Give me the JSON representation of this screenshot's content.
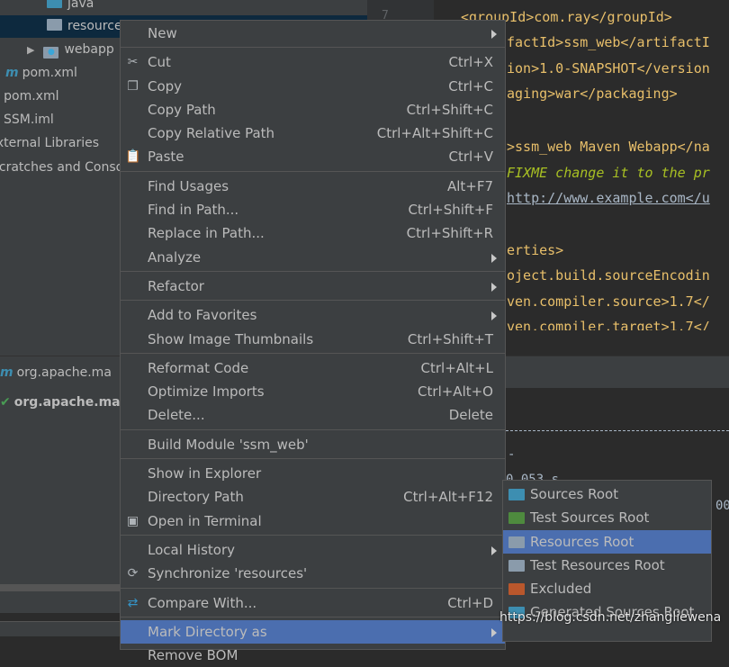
{
  "project_tree": {
    "items": [
      {
        "label": "java",
        "icon": "folder-icon"
      },
      {
        "label": "resources",
        "icon": "folder-icon",
        "selected": true
      },
      {
        "label": "webapp",
        "icon": "web-folder-icon"
      },
      {
        "label": "pom.xml",
        "icon": "maven-icon"
      },
      {
        "label": "pom.xml",
        "icon": "maven-icon"
      },
      {
        "label": "SSM.iml",
        "icon": "iml-icon"
      },
      {
        "label": "External Libraries"
      },
      {
        "label": "Scratches and Consoles"
      }
    ]
  },
  "gutter": {
    "line_number": "7"
  },
  "editor": {
    "lines": [
      "<groupId>com.ray</groupId>",
      "factId>ssm_web</artifactI",
      "ion>1.0-SNAPSHOT</version",
      "aging>war</packaging>",
      ">ssm_web Maven Webapp</na",
      "FIXME change it to the pr",
      "http://www.example.com</u",
      "erties>",
      "oject.build.sourceEncodin",
      "ven.compiler.source>1.7</",
      "ven.compiler.target>1.7</"
    ]
  },
  "run_panel": {
    "items": [
      "org.apache.ma",
      "org.apache.ma"
    ],
    "console": [
      "-",
      "0 053 s",
      "00"
    ]
  },
  "context_menu": {
    "groups": [
      [
        {
          "label": "New",
          "submenu": true
        }
      ],
      [
        {
          "label": "Cut",
          "shortcut": "Ctrl+X",
          "icon": "scissors-icon"
        },
        {
          "label": "Copy",
          "shortcut": "Ctrl+C",
          "icon": "copy-icon"
        },
        {
          "label": "Copy Path",
          "shortcut": "Ctrl+Shift+C"
        },
        {
          "label": "Copy Relative Path",
          "shortcut": "Ctrl+Alt+Shift+C"
        },
        {
          "label": "Paste",
          "shortcut": "Ctrl+V",
          "icon": "clipboard-icon"
        }
      ],
      [
        {
          "label": "Find Usages",
          "shortcut": "Alt+F7"
        },
        {
          "label": "Find in Path...",
          "shortcut": "Ctrl+Shift+F"
        },
        {
          "label": "Replace in Path...",
          "shortcut": "Ctrl+Shift+R"
        },
        {
          "label": "Analyze",
          "submenu": true
        }
      ],
      [
        {
          "label": "Refactor",
          "submenu": true
        }
      ],
      [
        {
          "label": "Add to Favorites",
          "submenu": true
        },
        {
          "label": "Show Image Thumbnails",
          "shortcut": "Ctrl+Shift+T"
        }
      ],
      [
        {
          "label": "Reformat Code",
          "shortcut": "Ctrl+Alt+L"
        },
        {
          "label": "Optimize Imports",
          "shortcut": "Ctrl+Alt+O"
        },
        {
          "label": "Delete...",
          "shortcut": "Delete"
        }
      ],
      [
        {
          "label": "Build Module 'ssm_web'"
        }
      ],
      [
        {
          "label": "Show in Explorer"
        },
        {
          "label": "Directory Path",
          "shortcut": "Ctrl+Alt+F12"
        },
        {
          "label": "Open in Terminal",
          "icon": "terminal-icon"
        }
      ],
      [
        {
          "label": "Local History",
          "submenu": true
        },
        {
          "label": "Synchronize 'resources'",
          "icon": "sync-icon"
        }
      ],
      [
        {
          "label": "Compare With...",
          "shortcut": "Ctrl+D",
          "icon": "compare-icon"
        }
      ],
      [
        {
          "label": "Mark Directory as",
          "submenu": true,
          "highlighted": true
        },
        {
          "label": "Remove BOM"
        }
      ]
    ]
  },
  "submenu": {
    "items": [
      {
        "label": "Sources Root",
        "color": "#3d8eb1"
      },
      {
        "label": "Test Sources Root",
        "color": "#4e8a3e"
      },
      {
        "label": "Resources Root",
        "color": "#8a9bab",
        "highlighted": true
      },
      {
        "label": "Test Resources Root",
        "color": "#8a9bab"
      },
      {
        "label": "Excluded",
        "color": "#b9572c"
      },
      {
        "label": "Generated Sources Root",
        "color": "#3d8eb1"
      }
    ]
  },
  "watermark": "https://blog.csdn.net/zhangliewena",
  "colors": {
    "accent": "#4b6eaf",
    "menu_bg": "#3c3f41",
    "editor_bg": "#2b2b2b",
    "tag": "#e8bf6a"
  }
}
